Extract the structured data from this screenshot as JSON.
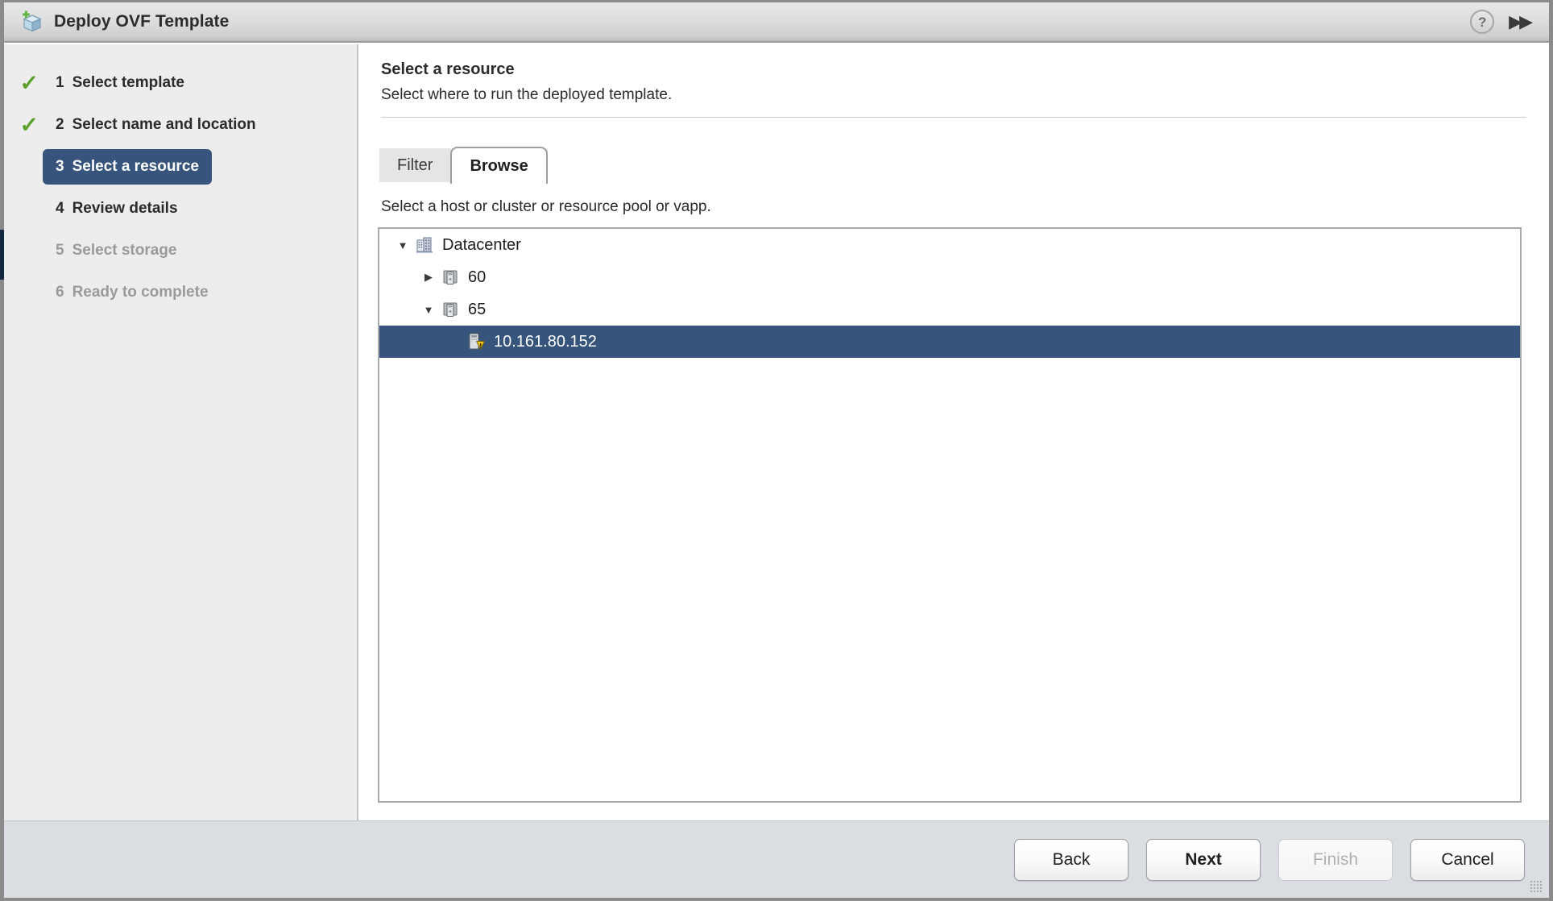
{
  "window": {
    "title": "Deploy OVF Template",
    "icon": "ovf-template-cube-icon",
    "help_icon": "?",
    "collapse_icon": "▶▶"
  },
  "sidebar": {
    "steps": [
      {
        "num": "1",
        "label": "Select template",
        "state": "done"
      },
      {
        "num": "2",
        "label": "Select name and location",
        "state": "done"
      },
      {
        "num": "3",
        "label": "Select a resource",
        "state": "active"
      },
      {
        "num": "4",
        "label": "Review details",
        "state": "enabled"
      },
      {
        "num": "5",
        "label": "Select storage",
        "state": "disabled"
      },
      {
        "num": "6",
        "label": "Ready to complete",
        "state": "disabled"
      }
    ],
    "check_glyph": "✓"
  },
  "main": {
    "title": "Select a resource",
    "subtitle": "Select where to run the deployed template.",
    "tabs": [
      {
        "label": "Filter",
        "active": false
      },
      {
        "label": "Browse",
        "active": true
      }
    ],
    "browse_hint": "Select a host or cluster or resource pool or vapp.",
    "tree": [
      {
        "label": "Datacenter",
        "icon": "datacenter-icon",
        "twisty": "expanded",
        "indent": 0,
        "selected": false
      },
      {
        "label": "60",
        "icon": "cluster-icon",
        "twisty": "collapsed",
        "indent": 1,
        "selected": false
      },
      {
        "label": "65",
        "icon": "cluster-icon",
        "twisty": "expanded",
        "indent": 1,
        "selected": false
      },
      {
        "label": "10.161.80.152",
        "icon": "host-warning-icon",
        "twisty": "none",
        "indent": 2,
        "selected": true
      }
    ]
  },
  "footer": {
    "buttons": [
      {
        "label": "Back",
        "state": "enabled"
      },
      {
        "label": "Next",
        "state": "primary"
      },
      {
        "label": "Finish",
        "state": "disabled"
      },
      {
        "label": "Cancel",
        "state": "enabled"
      }
    ]
  },
  "colors": {
    "selection_blue": "#36547c",
    "check_green": "#5aa02c",
    "footer_bg": "#dadde2",
    "sidebar_bg": "#ededed",
    "warning_yellow": "#f5c518"
  }
}
